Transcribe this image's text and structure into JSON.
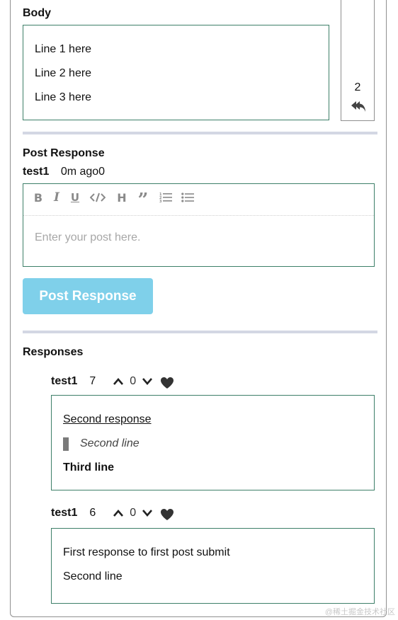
{
  "post": {
    "body_heading": "Body",
    "body_lines": [
      "Line 1 here",
      "Line 2 here",
      "Line 3 here"
    ],
    "reply_count": "2"
  },
  "response_form": {
    "heading": "Post Response",
    "user": "test1",
    "time": "0m ago0",
    "editor_placeholder": "Enter your post here.",
    "submit_label": "Post Response"
  },
  "responses": {
    "heading": "Responses",
    "items": [
      {
        "user": "test1",
        "id": "7",
        "votes": "0",
        "line1": "Second response",
        "quote": "Second line",
        "line3": "Third line"
      },
      {
        "user": "test1",
        "id": "6",
        "votes": "0",
        "line1": "First response to first post submit",
        "line2": "Second line"
      }
    ]
  },
  "watermark": "@稀土掘金技术社区",
  "colors": {
    "box_border": "#3d7f68",
    "divider": "#d3d7e3",
    "button_bg": "#7fd0ea",
    "toolbar_icon": "#8a8a8a"
  }
}
